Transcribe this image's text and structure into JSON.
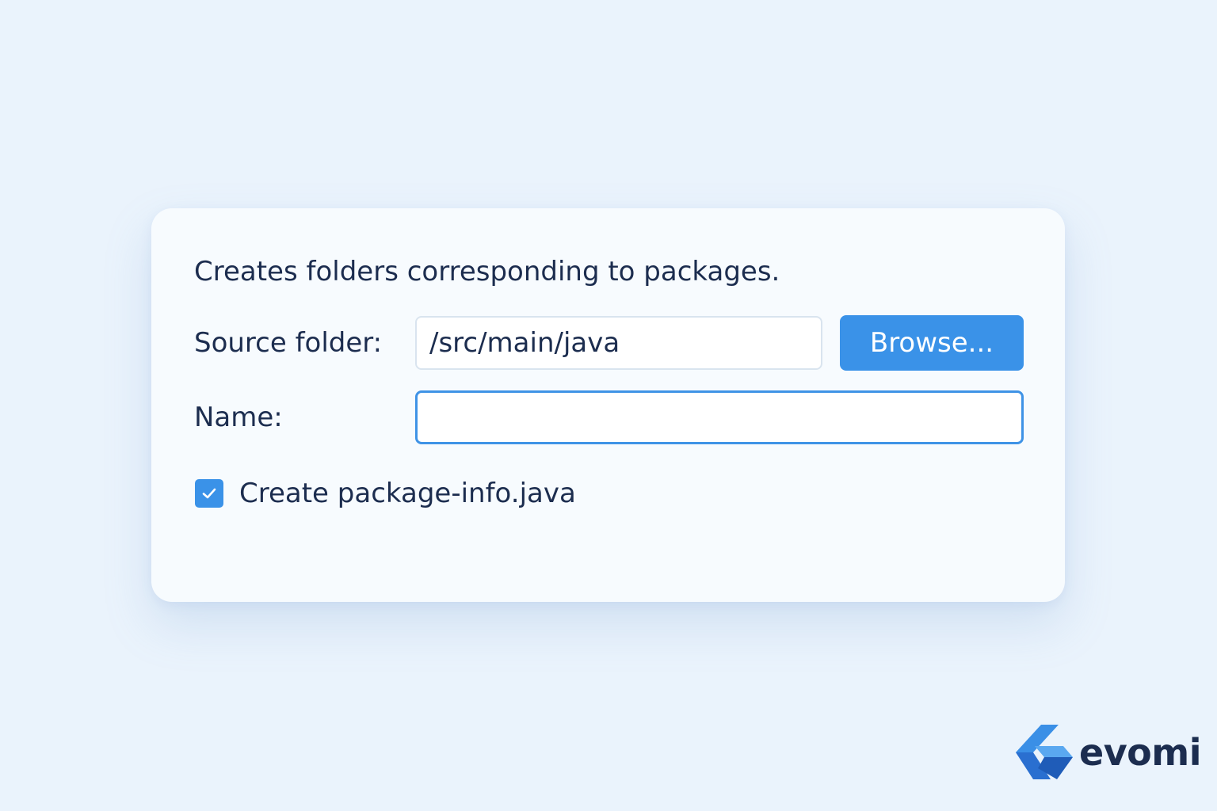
{
  "dialog": {
    "description": "Creates folders corresponding to packages.",
    "source_folder": {
      "label": "Source folder:",
      "value": "/src/main/java"
    },
    "browse_label": "Browse...",
    "name": {
      "label": "Name:",
      "value": ""
    },
    "package_info": {
      "label": "Create package-info.java",
      "checked": true
    }
  },
  "brand": {
    "name": "evomi",
    "icon": "evomi-logo-icon"
  },
  "colors": {
    "accent": "#3a92e8",
    "text": "#1c2d4f",
    "background": "#eaf3fc",
    "card": "#f7fbfe"
  }
}
